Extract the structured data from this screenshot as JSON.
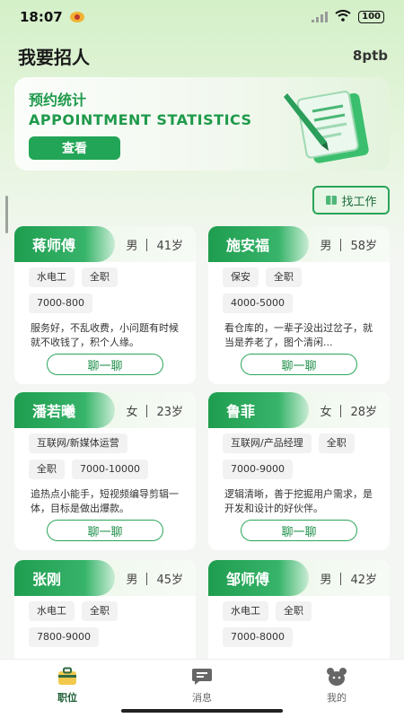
{
  "status": {
    "time": "18:07",
    "battery": "100"
  },
  "header": {
    "title": "我要招人",
    "right": "8ptb"
  },
  "banner": {
    "title": "预约统计",
    "subtitle": "APPOINTMENT STATISTICS",
    "button": "查看"
  },
  "find_job": "找工作",
  "cards": [
    {
      "name": "蒋师傅",
      "gender": "男",
      "age": "41岁",
      "tags": [
        "水电工",
        "全职"
      ],
      "salary": "7000-800",
      "desc": "服务好，不乱收费，小问题有时候就不收钱了，积个人缘。",
      "chat": "聊一聊"
    },
    {
      "name": "施安福",
      "gender": "男",
      "age": "58岁",
      "tags": [
        "保安",
        "全职"
      ],
      "salary": "4000-5000",
      "desc": "看仓库的，一辈子没出过岔子，就当是养老了，图个清闲...",
      "chat": "聊一聊"
    },
    {
      "name": "潘若曦",
      "gender": "女",
      "age": "23岁",
      "tags": [
        "互联网/新媒体运营"
      ],
      "salary_tags": [
        "全职",
        "7000-10000"
      ],
      "desc": "追热点小能手，短视频编导剪辑一体，目标是做出爆款。",
      "chat": "聊一聊"
    },
    {
      "name": "鲁菲",
      "gender": "女",
      "age": "28岁",
      "tags": [
        "互联网/产品经理",
        "全职"
      ],
      "salary": "7000-9000",
      "desc": "逻辑清晰，善于挖掘用户需求，是开发和设计的好伙伴。",
      "chat": "聊一聊"
    },
    {
      "name": "张刚",
      "gender": "男",
      "age": "45岁",
      "tags": [
        "水电工",
        "全职"
      ],
      "salary": "7800-9000"
    },
    {
      "name": "邹师傅",
      "gender": "男",
      "age": "42岁",
      "tags": [
        "水电工",
        "全职"
      ],
      "salary": "7000-8000"
    }
  ],
  "tabbar": [
    {
      "label": "职位",
      "icon": "briefcase-icon"
    },
    {
      "label": "消息",
      "icon": "message-icon"
    },
    {
      "label": "我的",
      "icon": "bear-icon"
    }
  ],
  "colors": {
    "primary": "#22a556",
    "accent_light": "#e8f6e6"
  }
}
